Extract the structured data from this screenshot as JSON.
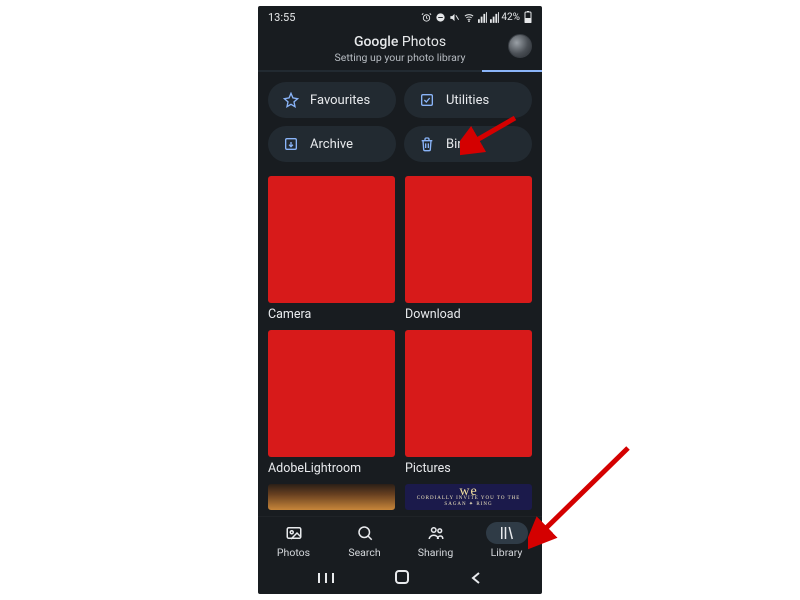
{
  "statusbar": {
    "time": "13:55",
    "battery": "42%"
  },
  "header": {
    "title_brand": "Google",
    "title_product": "Photos",
    "subtitle": "Setting up your photo library"
  },
  "chips": {
    "favourites": "Favourites",
    "utilities": "Utilities",
    "archive": "Archive",
    "bin": "Bin"
  },
  "albums": [
    {
      "label": "Camera"
    },
    {
      "label": "Download"
    },
    {
      "label": "AdobeLightroom"
    },
    {
      "label": "Pictures"
    }
  ],
  "invite": {
    "line1": "CORDIALLY INVITE YOU TO THE",
    "line2": "SAGAN ✦ RING"
  },
  "nav": {
    "photos": "Photos",
    "search": "Search",
    "sharing": "Sharing",
    "library": "Library"
  }
}
